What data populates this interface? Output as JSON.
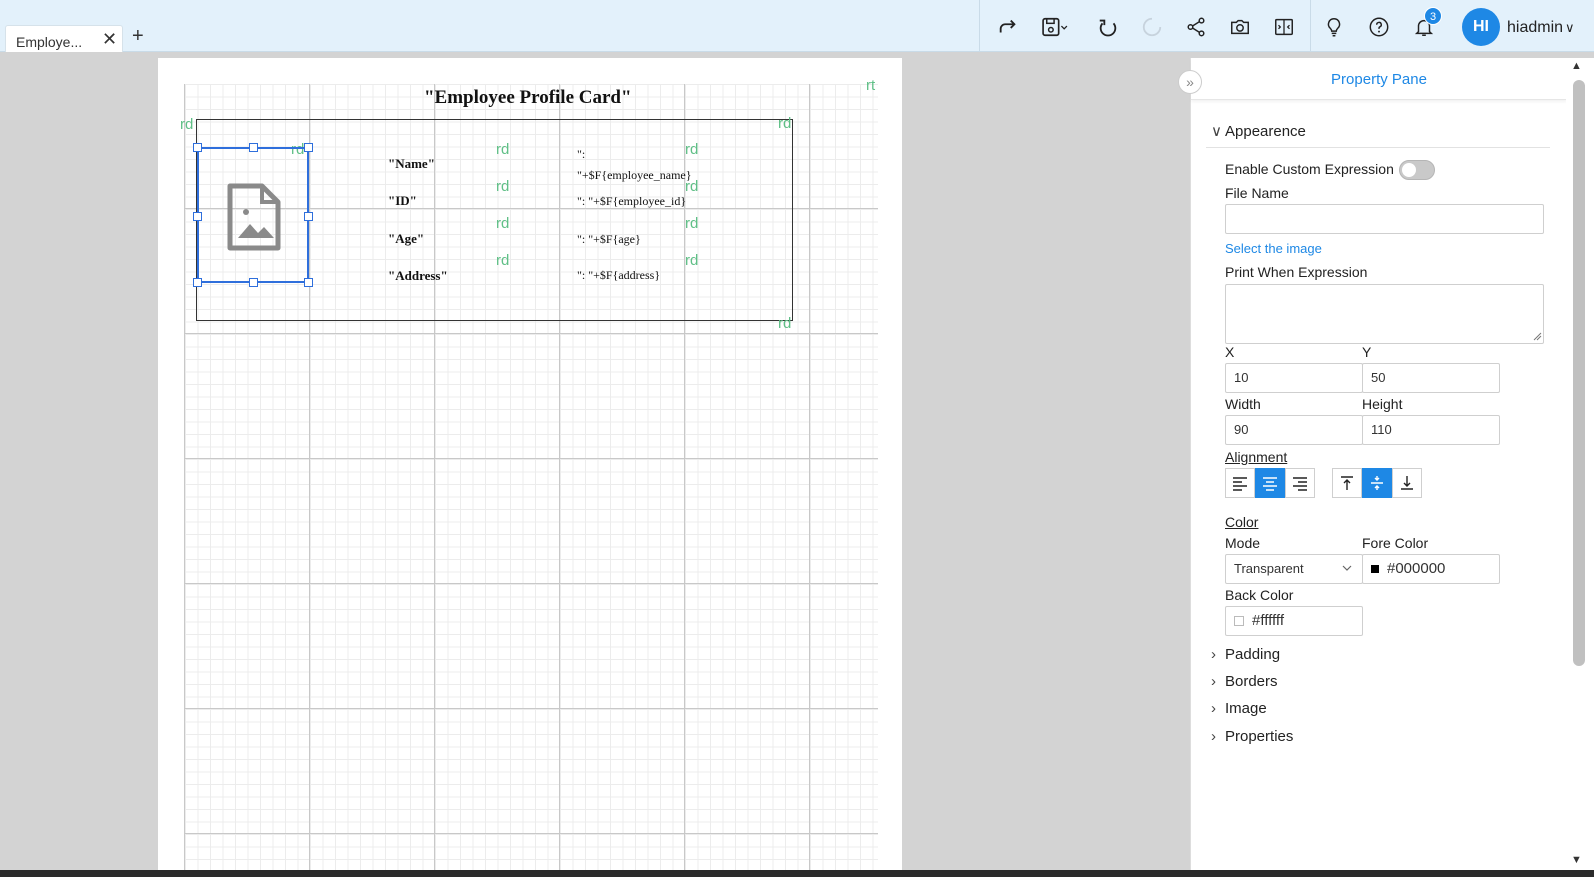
{
  "tabs": [
    {
      "label": "Employe...",
      "close_icon": "close-icon"
    }
  ],
  "add_tab_icon": "plus-icon",
  "toolbar": {
    "icons": [
      "redo-icon",
      "save-icon",
      "refresh-icon",
      "loading-icon",
      "share-icon",
      "preview-icon",
      "layout-icon",
      "lightbulb-icon",
      "help-icon",
      "bell-icon"
    ],
    "notification_count": "3",
    "avatar_initials": "HI",
    "user_name": "hiadmin"
  },
  "canvas": {
    "title": "\"Employee Profile Card\"",
    "marker_rd": "rd",
    "marker_rt": "rt",
    "fields": [
      {
        "label": "\"Name\"",
        "value_line1": "\":",
        "value_line2": "\"+$F{employee_name}"
      },
      {
        "label": "\"ID\"",
        "value": "\": \"+$F{employee_id}"
      },
      {
        "label": "\"Age\"",
        "value": "\": \"+$F{age}"
      },
      {
        "label": "\"Address\"",
        "value": "\": \"+$F{address}"
      }
    ],
    "image_icon": "image-file-icon"
  },
  "pane": {
    "title": "Property Pane",
    "collapse_icon": "double-chevron-right-icon",
    "appearance": {
      "heading": "Appearence",
      "enable_custom_expression_label": "Enable Custom Expression",
      "enable_custom_expression": false,
      "file_name_label": "File Name",
      "file_name_value": "",
      "select_image_link": "Select the image",
      "print_when_label": "Print When Expression",
      "print_when_value": "",
      "x_label": "X",
      "x_value": "10",
      "y_label": "Y",
      "y_value": "50",
      "width_label": "Width",
      "width_value": "90",
      "height_label": "Height",
      "height_value": "110",
      "alignment_label": "Alignment",
      "horizontal_alignment": "center",
      "vertical_alignment": "middle",
      "color_label": "Color",
      "mode_label": "Mode",
      "mode_value": "Transparent",
      "fore_color_label": "Fore Color",
      "fore_color_value": "#000000",
      "back_color_label": "Back Color",
      "back_color_value": "#ffffff"
    },
    "sections": [
      "Padding",
      "Borders",
      "Image",
      "Properties"
    ]
  },
  "colors": {
    "accent": "#1e88e5",
    "marker": "#5fbf86",
    "selection": "#2f6fdc",
    "topbar": "#e3f1fb"
  }
}
